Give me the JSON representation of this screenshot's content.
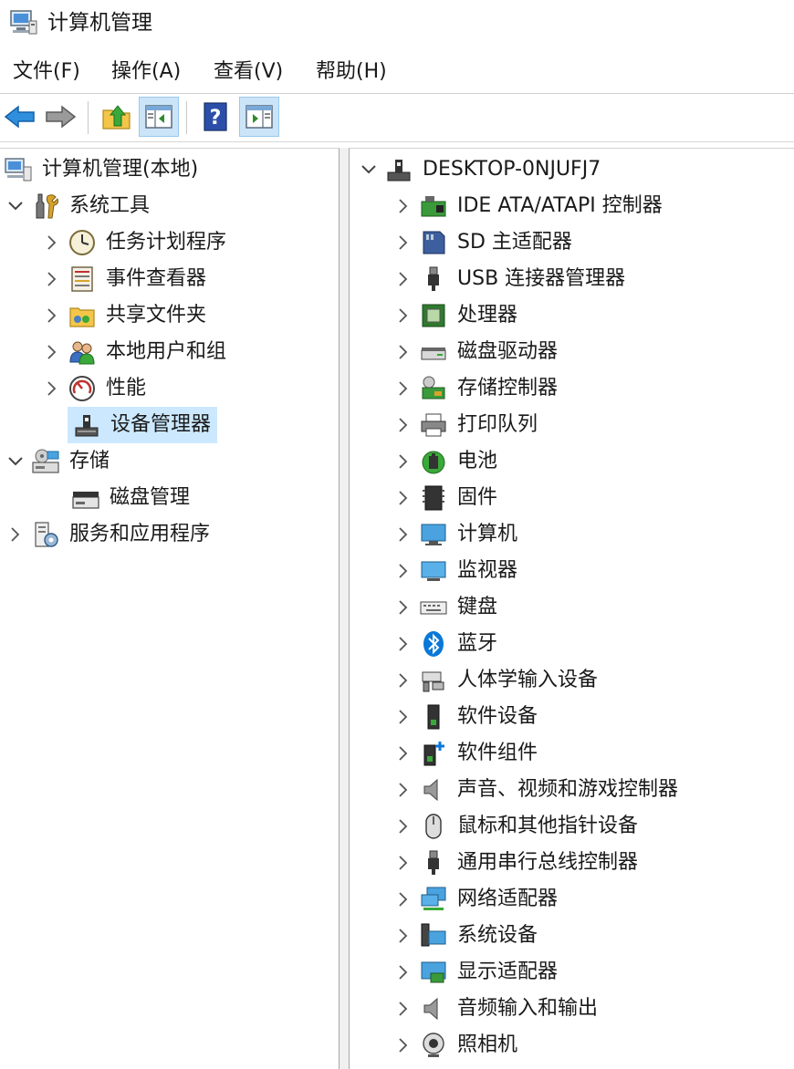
{
  "window": {
    "title": "计算机管理"
  },
  "menu": [
    {
      "label": "文件(F)"
    },
    {
      "label": "操作(A)"
    },
    {
      "label": "查看(V)"
    },
    {
      "label": "帮助(H)"
    }
  ],
  "toolbar": {
    "buttons": [
      "back-icon",
      "forward-icon",
      "up-folder-icon",
      "show-hide-console-tree-icon",
      "help-icon",
      "show-hide-action-pane-icon"
    ]
  },
  "left_tree": {
    "root": "计算机管理(本地)",
    "system_tools": "系统工具",
    "task_scheduler": "任务计划程序",
    "event_viewer": "事件查看器",
    "shared_folders": "共享文件夹",
    "local_users": "本地用户和组",
    "performance": "性能",
    "device_manager": "设备管理器",
    "storage": "存储",
    "disk_management": "磁盘管理",
    "services": "服务和应用程序"
  },
  "device_tree": {
    "root": "DESKTOP-0NJUFJ7",
    "categories": [
      {
        "label": "IDE ATA/ATAPI 控制器",
        "icon": "ide-controller-icon"
      },
      {
        "label": "SD 主适配器",
        "icon": "sd-adapter-icon"
      },
      {
        "label": "USB 连接器管理器",
        "icon": "usb-connector-icon"
      },
      {
        "label": "处理器",
        "icon": "processor-icon"
      },
      {
        "label": "磁盘驱动器",
        "icon": "disk-drive-icon"
      },
      {
        "label": "存储控制器",
        "icon": "storage-controller-icon"
      },
      {
        "label": "打印队列",
        "icon": "printer-icon"
      },
      {
        "label": "电池",
        "icon": "battery-icon"
      },
      {
        "label": "固件",
        "icon": "firmware-icon"
      },
      {
        "label": "计算机",
        "icon": "computer-icon"
      },
      {
        "label": "监视器",
        "icon": "monitor-icon"
      },
      {
        "label": "键盘",
        "icon": "keyboard-icon"
      },
      {
        "label": "蓝牙",
        "icon": "bluetooth-icon"
      },
      {
        "label": "人体学输入设备",
        "icon": "hid-icon"
      },
      {
        "label": "软件设备",
        "icon": "software-device-icon"
      },
      {
        "label": "软件组件",
        "icon": "software-component-icon"
      },
      {
        "label": "声音、视频和游戏控制器",
        "icon": "speaker-icon"
      },
      {
        "label": "鼠标和其他指针设备",
        "icon": "mouse-icon"
      },
      {
        "label": "通用串行总线控制器",
        "icon": "usb-controller-icon"
      },
      {
        "label": "网络适配器",
        "icon": "network-adapter-icon"
      },
      {
        "label": "系统设备",
        "icon": "system-device-icon"
      },
      {
        "label": "显示适配器",
        "icon": "display-adapter-icon"
      },
      {
        "label": "音频输入和输出",
        "icon": "audio-io-icon"
      },
      {
        "label": "照相机",
        "icon": "camera-icon"
      }
    ]
  },
  "colors": {
    "selection": "#cce8ff",
    "accent": "#0a78d7"
  }
}
